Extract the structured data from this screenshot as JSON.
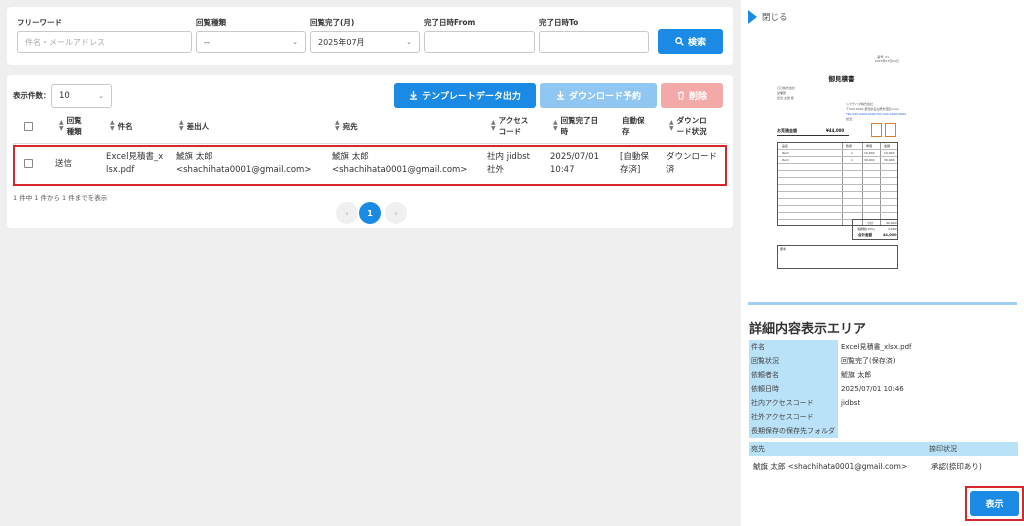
{
  "filters": {
    "freeword": {
      "label": "フリーワード",
      "placeholder": "件名・メールアドレス"
    },
    "circulation_type": {
      "label": "回覧種類",
      "value": "--"
    },
    "completed_month": {
      "label": "回覧完了(月)",
      "value": "2025年07月"
    },
    "completed_from": {
      "label": "完了日時From",
      "value": ""
    },
    "completed_to": {
      "label": "完了日時To",
      "value": ""
    },
    "search_label": "検索"
  },
  "results": {
    "count_label": "表示件数：",
    "count_value": "10",
    "template_btn": "テンプレートデータ出力",
    "download_btn": "ダウンロード予約",
    "delete_btn": "削除",
    "columns": {
      "type": [
        "回覧",
        "種類"
      ],
      "subject": "件名",
      "sender": "差出人",
      "recipient": "宛先",
      "access": [
        "アクセス",
        "コード"
      ],
      "completed": [
        "回覧完了日",
        "時"
      ],
      "auto_save": [
        "自動保",
        "存"
      ],
      "download_status": [
        "ダウンロ",
        "ード状況"
      ]
    },
    "row": {
      "type": "送信",
      "subject": [
        "Excel見積書_x",
        "lsx.pdf"
      ],
      "sender": [
        "鯱旗 太郎",
        "<shachihata0001@gmail.com>"
      ],
      "recipient": [
        "鯱旗 太郎",
        "<shachihata0001@gmail.com>"
      ],
      "access": [
        "社内 jidbst",
        "社外"
      ],
      "completed": [
        "2025/07/01",
        "10:47"
      ],
      "auto_save": [
        "[自動保",
        "存済]"
      ],
      "download_status": [
        "ダウンロード",
        "済"
      ]
    },
    "summary": "1 件中 1 件から 1 件までを表示",
    "pager": {
      "prev": "‹",
      "current": "1",
      "next": "›"
    }
  },
  "panel": {
    "close_label": "閉じる",
    "preview": {
      "title": "御見積書",
      "meta_no": "番号: 01",
      "meta_date": "2025年07月01日",
      "customer": "〇〇株式会社",
      "customer_dept": "営業部",
      "customer_person": "担当 太郎 様",
      "issuer": "シヤチハタ株式会社",
      "issuer_addr": "〒000-0000 愛知県名古屋市西区xxxx",
      "issuer_tel": "TEL:000-0000-0000 FAX:000-0000-0000",
      "issuer_mail": "担当：",
      "amount_label": "お見積金額",
      "amount_value": "¥44,000",
      "col_item": "品名",
      "col_qty": "数量",
      "col_price": "単価",
      "col_amount": "金額",
      "lines": [
        {
          "item": "Item",
          "qty": "1",
          "price": "10,000",
          "amount": "10,000"
        },
        {
          "item": "Item",
          "qty": "1",
          "price": "30,000",
          "amount": "30,000"
        }
      ],
      "subtotal_label": "小計",
      "subtotal": "40,000",
      "tax_label": "消費税(10%)",
      "tax": "4,000",
      "total_label": "合計金額",
      "total": "44,000",
      "remarks_label": "備考"
    },
    "detail_title": "詳細内容表示エリア",
    "details": [
      {
        "label": "件名",
        "value": "Excel見積書_xlsx.pdf"
      },
      {
        "label": "回覧状況",
        "value": "回覧完了(保存済)"
      },
      {
        "label": "依頼者名",
        "value": "鯱旗 太郎"
      },
      {
        "label": "依頼日時",
        "value": "2025/07/01 10:46"
      },
      {
        "label": "社内アクセスコード",
        "value": "jidbst"
      },
      {
        "label": "社外アクセスコード",
        "value": ""
      },
      {
        "label": "長期保存の保存先フォルダ",
        "value": ""
      }
    ],
    "dest_header": "宛先",
    "stamp_header": "捺印状況",
    "dest_value": "鯱旗 太郎 <shachihata0001@gmail.com>",
    "stamp_value": "承認(捺印あり)",
    "show_btn": "表示"
  },
  "colors": {
    "primary": "#1a8ae5",
    "highlight": "#d7262c",
    "label_bg": "#b9e1f7"
  },
  "icons": [
    "search-icon",
    "download-icon",
    "trash-icon",
    "sort-icon",
    "triangle-right-icon",
    "chevron-down-icon"
  ]
}
